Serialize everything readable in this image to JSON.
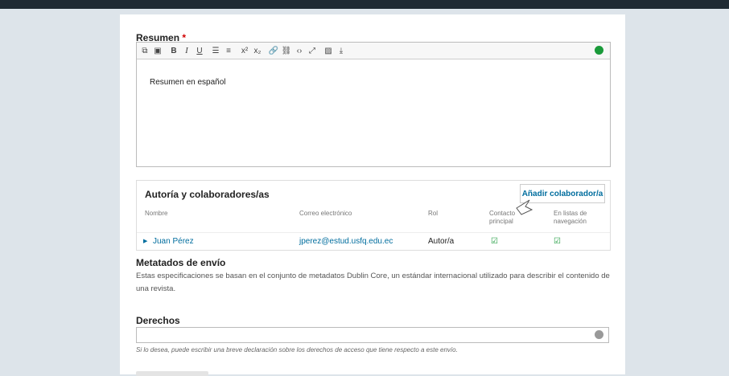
{
  "abstract": {
    "label": "Resumen",
    "required_mark": "*",
    "content": "Resumen en español",
    "toolbar_icons": [
      "copy-icon",
      "paste-icon",
      "bold-icon",
      "italic-icon",
      "underline-icon",
      "bullet-list-icon",
      "numbered-list-icon",
      "superscript-icon",
      "subscript-icon",
      "link-icon",
      "unlink-icon",
      "code-icon",
      "fullscreen-icon",
      "image-icon",
      "upload-icon"
    ]
  },
  "authors": {
    "title": "Autoría y colaboradores/as",
    "add_button": "Añadir colaborador/a",
    "columns": {
      "name": "Nombre",
      "email": "Correo electrónico",
      "role": "Rol",
      "primary": "Contacto principal",
      "browse": "En listas de navegación"
    },
    "rows": [
      {
        "name": "Juan Pérez",
        "email": "jperez@estud.usfq.edu.ec",
        "role": "Autor/a",
        "primary": true,
        "browse": true
      }
    ]
  },
  "metadata": {
    "title": "Metatados de envío",
    "description": "Estas especificaciones se basan en el conjunto de metadatos Dublin Core, un estándar internacional utilizado para describir el contenido de una revista."
  },
  "rights": {
    "title": "Derechos",
    "value": "",
    "help": "Si lo desea, puede escribir una breve declaración sobre los derechos de acceso que tiene respecto a este envío."
  },
  "colors": {
    "accent": "#006d9e",
    "required": "#d00000",
    "check": "#1a9a3a"
  }
}
